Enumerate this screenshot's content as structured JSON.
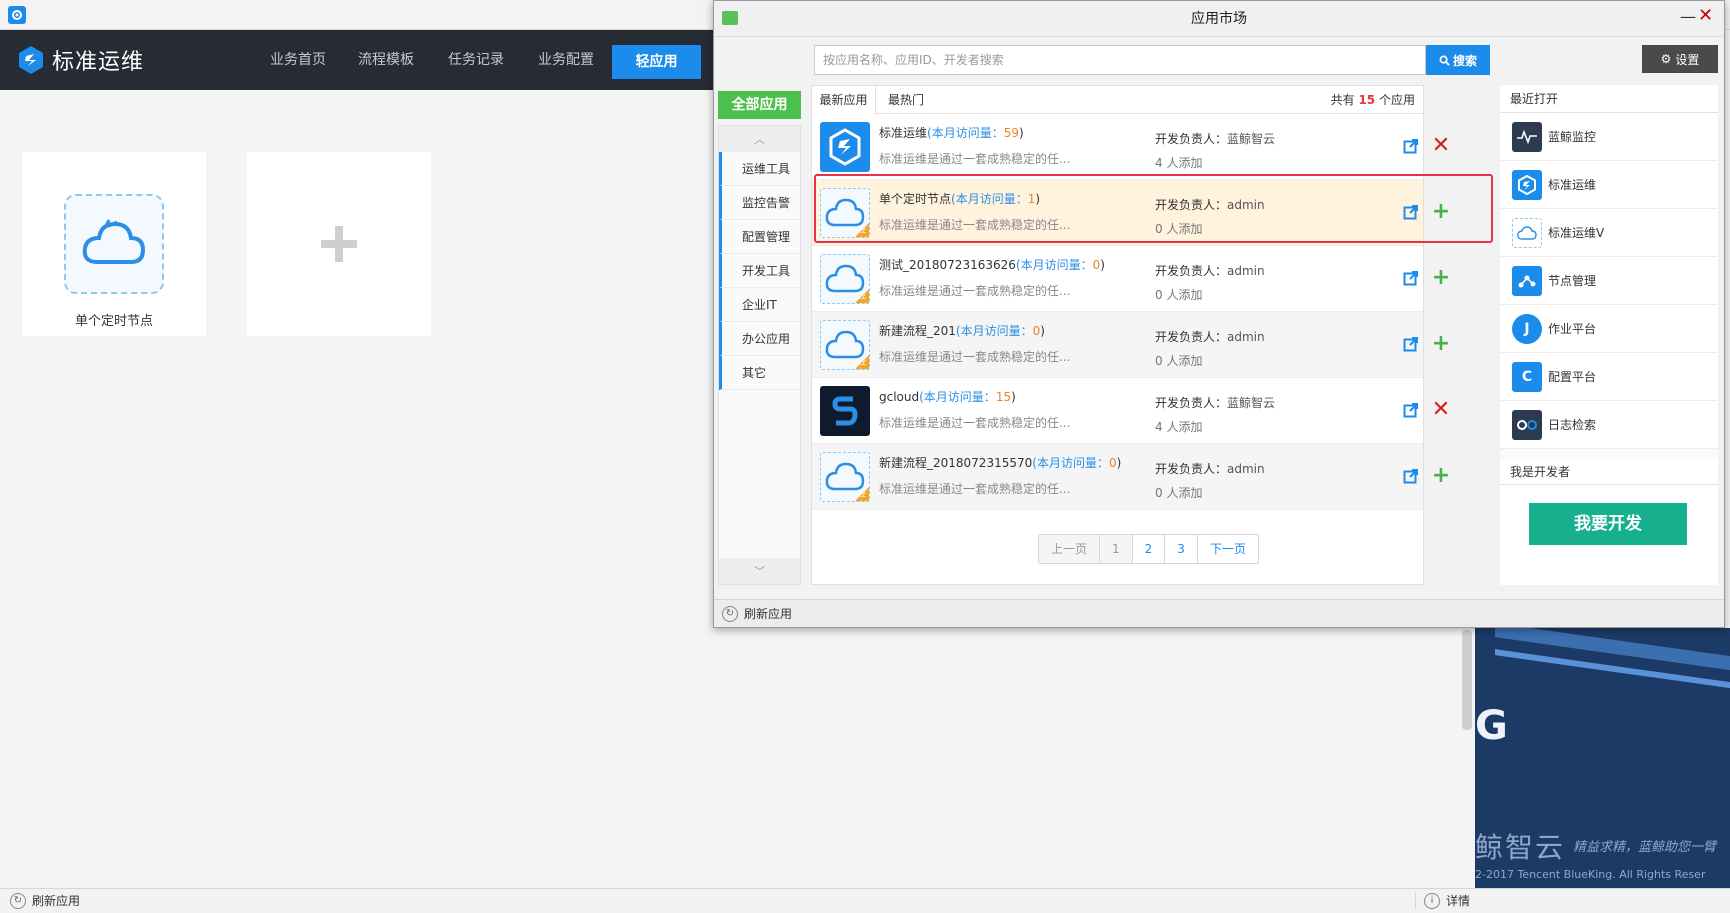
{
  "outer": {
    "logo_text": "标准运维",
    "nav": [
      "业务首页",
      "流程模板",
      "任务记录",
      "业务配置"
    ],
    "nav_active_btn": "轻应用",
    "tiles": [
      {
        "label": "单个定时节点"
      }
    ],
    "bottom": {
      "refresh": "刷新应用",
      "detail": "详情"
    }
  },
  "desktop": {
    "letter": "G",
    "brand": "鲸智云",
    "slogan": "精益求精，蓝鲸助您一臂",
    "copyright": "2-2017 Tencent BlueKing. All Rights Reser"
  },
  "market": {
    "title": "应用市场",
    "search_placeholder": "按应用名称、应用ID、开发者搜索",
    "search_btn": "搜索",
    "settings_btn": "设置",
    "all_apps": "全部应用",
    "categories": [
      "运维工具",
      "监控告警",
      "配置管理",
      "开发工具",
      "企业IT",
      "办公应用",
      "其它"
    ],
    "tabs": {
      "new": "最新应用",
      "hot": "最热门"
    },
    "count": {
      "prefix": "共有",
      "num": "15",
      "suffix": "个应用"
    },
    "apps": [
      {
        "name": "标准运维",
        "visits_label": "(本月访问量：",
        "visits": "59",
        "close": ")",
        "desc": "标准运维是通过一套成熟稳定的任...",
        "dev_label": "开发负责人：",
        "dev": "蓝鲸智云",
        "added": "4 人添加",
        "action": "remove"
      },
      {
        "name": "单个定时节点",
        "visits_label": "(本月访问量：",
        "visits": "1",
        "close": ")",
        "desc": "标准运维是通过一套成熟稳定的任...",
        "dev_label": "开发负责人：",
        "dev": "admin",
        "added": "0 人添加",
        "action": "add"
      },
      {
        "name": "测试_20180723163626",
        "visits_label": "(本月访问量：",
        "visits": "0",
        "close": ")",
        "desc": "标准运维是通过一套成熟稳定的任...",
        "dev_label": "开发负责人：",
        "dev": "admin",
        "added": "0 人添加",
        "action": "add"
      },
      {
        "name": "新建流程_201",
        "visits_label": "(本月访问量：",
        "visits": "0",
        "close": ")",
        "desc": "标准运维是通过一套成熟稳定的任...",
        "dev_label": "开发负责人：",
        "dev": "admin",
        "added": "0 人添加",
        "action": "add"
      },
      {
        "name": "gcloud",
        "visits_label": "(本月访问量：",
        "visits": "15",
        "close": ")",
        "desc": "标准运维是通过一套成熟稳定的任...",
        "dev_label": "开发负责人：",
        "dev": "蓝鲸智云",
        "added": "4 人添加",
        "action": "remove"
      },
      {
        "name": "新建流程_2018072315570",
        "visits_label": "(本月访问量：",
        "visits": "0",
        "close": ")",
        "desc": "标准运维是通过一套成熟稳定的任...",
        "dev_label": "开发负责人：",
        "dev": "admin",
        "added": "0 人添加",
        "action": "add"
      }
    ],
    "pager": {
      "prev": "上一页",
      "pages": [
        "1",
        "2",
        "3"
      ],
      "next": "下一页"
    },
    "recent_title": "最近打开",
    "recent": [
      {
        "label": "蓝鲸监控",
        "color": "#2d3b4e"
      },
      {
        "label": "标准运维",
        "color": "#1b8ceb"
      },
      {
        "label": "标准运维V",
        "color": "#ffffff"
      },
      {
        "label": "节点管理",
        "color": "#1b8ceb"
      },
      {
        "label": "作业平台",
        "color": "#1b8ceb"
      },
      {
        "label": "配置平台",
        "color": "#1b8ceb"
      },
      {
        "label": "日志检索",
        "color": "#2d3b4e"
      }
    ],
    "dev_title": "我是开发者",
    "dev_btn": "我要开发",
    "bottom_refresh": "刷新应用"
  }
}
